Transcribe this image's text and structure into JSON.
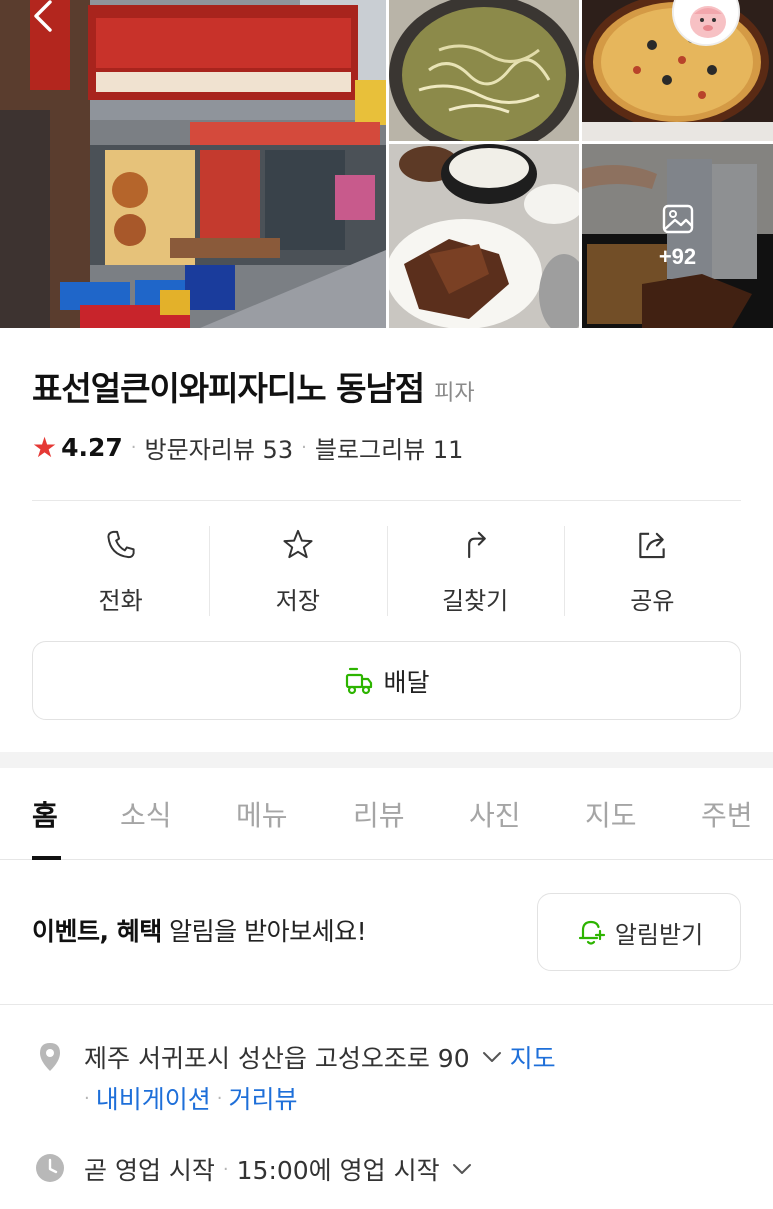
{
  "gallery": {
    "more_count": "+92",
    "photos": [
      "restaurant-storefront",
      "bean-sprout-soup",
      "pizza",
      "grilled-chicken",
      "beer-and-chicken"
    ]
  },
  "place": {
    "name": "표선얼큰이와피자디노 동남점",
    "category": "피자",
    "rating": "4.27",
    "visitor_reviews": "방문자리뷰 53",
    "blog_reviews": "블로그리뷰 11"
  },
  "actions": [
    {
      "label": "전화",
      "icon": "phone-icon"
    },
    {
      "label": "저장",
      "icon": "star-outline-icon"
    },
    {
      "label": "길찾기",
      "icon": "directions-icon"
    },
    {
      "label": "공유",
      "icon": "share-icon"
    }
  ],
  "delivery": {
    "label": "배달",
    "icon": "delivery-truck-icon"
  },
  "tabs": [
    "홈",
    "소식",
    "메뉴",
    "리뷰",
    "사진",
    "지도",
    "주변"
  ],
  "active_tab": "홈",
  "notice": {
    "bold_text": "이벤트, 혜택",
    "text": " 알림을 받아보세요!",
    "button_label": "알림받기"
  },
  "address": {
    "text": "제주 서귀포시 성산읍 고성오조로 90",
    "map_link": "지도",
    "navigation_link": "내비게이션",
    "street_view_link": "거리뷰"
  },
  "hours": {
    "status": "곧 영업 시작",
    "detail": "15:00에 영업 시작"
  },
  "colors": {
    "accent_link": "#1e6fd9",
    "rating_star": "#e53935",
    "delivery_icon": "#2db400"
  }
}
